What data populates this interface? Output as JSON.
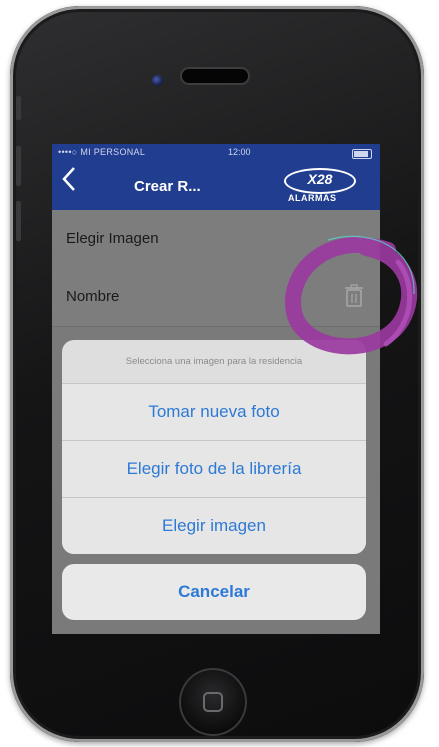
{
  "status_bar": {
    "carrier": "••••○ MI PERSONAL",
    "time": "12:00"
  },
  "nav": {
    "back_icon": "chevron-left-icon",
    "title": "Crear R...",
    "logo_brand": "X28",
    "logo_sub": "ALARMAS"
  },
  "form": {
    "choose_image_label": "Elegir Imagen",
    "name_label": "Nombre"
  },
  "action_sheet": {
    "message": "Selecciona una imagen para la residencia",
    "options": [
      "Tomar nueva foto",
      "Elegir foto de la librería",
      "Elegir imagen"
    ],
    "cancel_label": "Cancelar"
  },
  "colors": {
    "nav_bar": "#203d8f",
    "action_text": "#2d79d6",
    "annotation_ring": "#9a3aa0"
  }
}
